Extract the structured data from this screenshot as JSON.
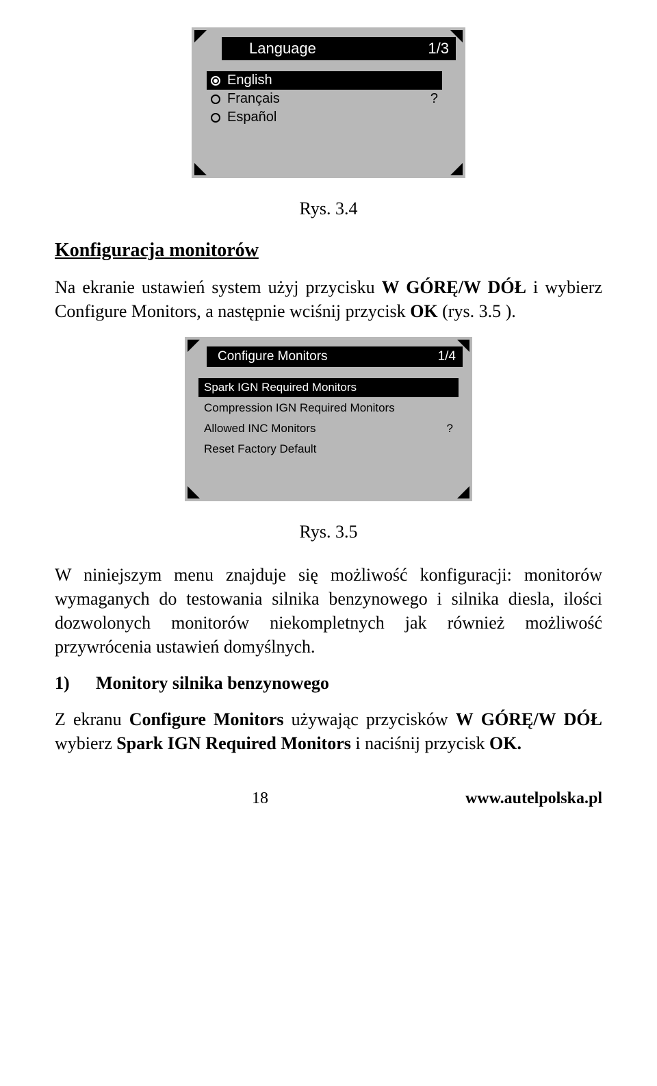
{
  "screen1": {
    "title": "Language",
    "page_indicator": "1/3",
    "languages": [
      "English",
      "Français",
      "Español"
    ],
    "selected_index": 0,
    "hint_mark": "?"
  },
  "caption1": "Rys. 3.4",
  "heading1": "Konfiguracja monitorów",
  "para1_pre": "Na ekranie ustawień system użyj przycisku ",
  "para1_b1": "W GÓRĘ/W DÓŁ",
  "para1_mid": " i wybierz Configure Monitors, a następnie wciśnij przycisk ",
  "para1_b2": "OK",
  "para1_post": " (rys. 3.5 ).",
  "screen2": {
    "title": "Configure  Monitors",
    "page_indicator": "1/4",
    "items": [
      "Spark IGN Required Monitors",
      "Compression IGN Required Monitors",
      "Allowed INC Monitors",
      "Reset Factory Default"
    ],
    "selected_index": 0,
    "hint_mark": "?",
    "hint_row_index": 2
  },
  "caption2": "Rys. 3.5",
  "para2": "W niniejszym menu znajduje się możliwość konfiguracji: monitorów wymaganych do testowania silnika benzynowego i silnika diesla, ilości dozwolonych monitorów niekompletnych jak również możliwość przywrócenia ustawień domyślnych.",
  "list1_num": "1)",
  "list1_text": "Monitory silnika benzynowego",
  "para3_pre": "Z ekranu ",
  "para3_b1": "Configure Monitors",
  "para3_mid1": " używając przycisków ",
  "para3_b2": "W GÓRĘ/W DÓŁ",
  "para3_mid2": " wybierz ",
  "para3_b3": "Spark IGN Required Monitors",
  "para3_mid3": " i naciśnij przycisk ",
  "para3_b4": "OK.",
  "footer": {
    "page_num": "18",
    "url": "www.autelpolska.pl"
  }
}
